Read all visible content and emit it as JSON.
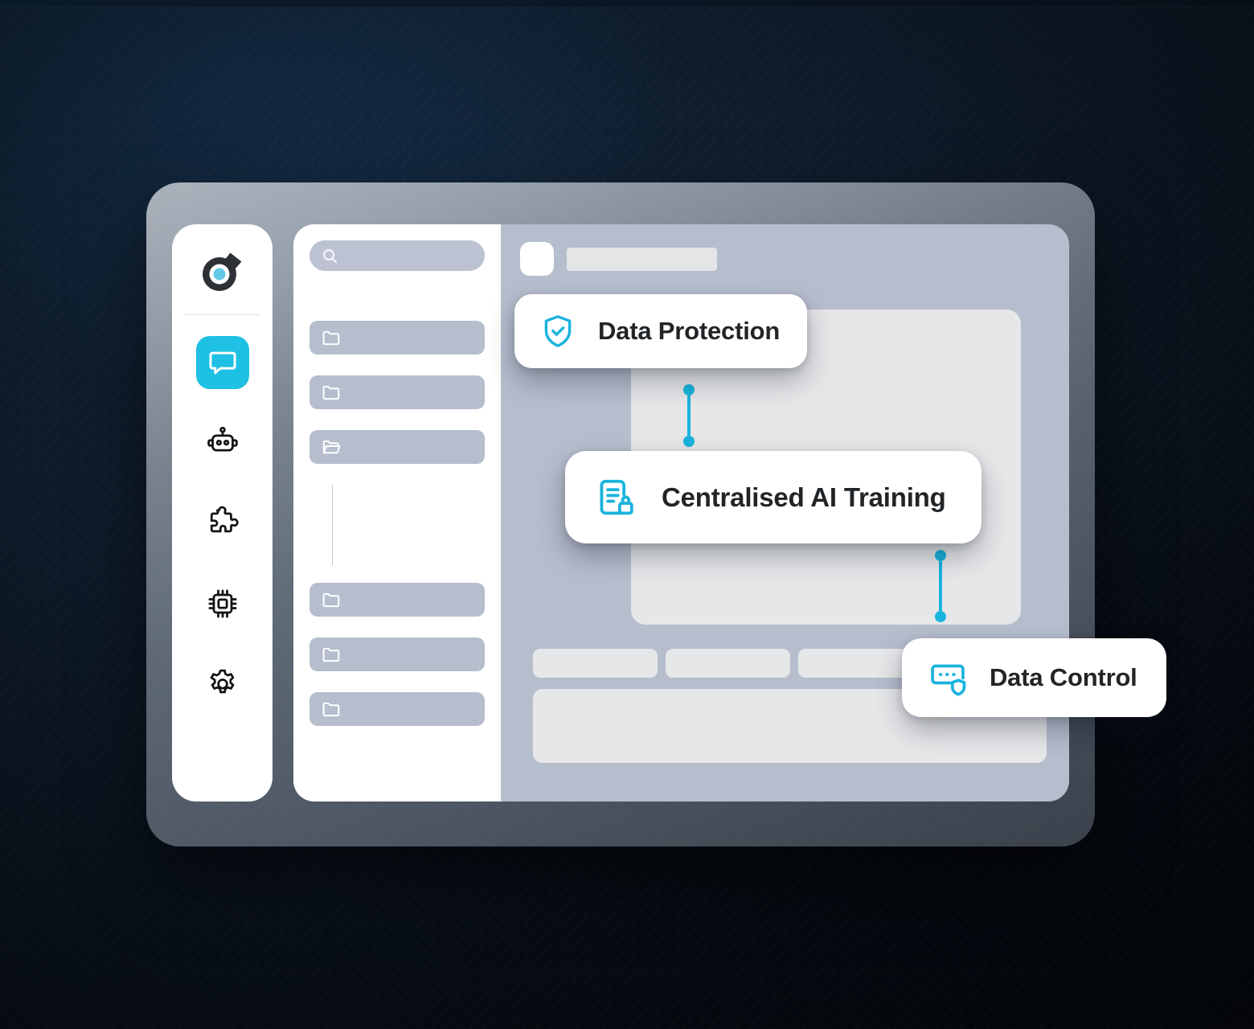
{
  "background": {
    "base_color": "#0d1a26",
    "accent_color": "#1ec0e3"
  },
  "brand": {
    "logo_icon": "target-pan-logo-icon",
    "logo_ring_color": "#2d3136",
    "logo_center_color": "#63c8e8"
  },
  "sidebar": {
    "items": [
      {
        "icon": "chat-bubble-icon",
        "active": true
      },
      {
        "icon": "robot-icon",
        "active": false
      },
      {
        "icon": "puzzle-piece-icon",
        "active": false
      },
      {
        "icon": "chip-icon",
        "active": false
      },
      {
        "icon": "gear-icon",
        "active": false
      }
    ]
  },
  "tree_panel": {
    "search": {
      "icon": "search-icon",
      "value": "",
      "placeholder": ""
    },
    "rows_top": [
      {
        "icon": "folder-closed-icon"
      },
      {
        "icon": "folder-closed-icon"
      },
      {
        "icon": "folder-open-icon"
      }
    ],
    "rows_bottom": [
      {
        "icon": "folder-closed-icon"
      },
      {
        "icon": "folder-closed-icon"
      },
      {
        "icon": "folder-closed-icon"
      }
    ]
  },
  "main": {
    "topbar": {
      "square_placeholder": "",
      "title_placeholder": ""
    },
    "chips": [
      "",
      "",
      ""
    ],
    "footer_block": ""
  },
  "badges": [
    {
      "id": "data-protection",
      "label": "Data Protection",
      "icon": "shield-check-icon",
      "icon_color": "#1ab3dd"
    },
    {
      "id": "centralised-ai-training",
      "label": "Centralised AI Training",
      "icon": "document-lock-icon",
      "icon_color": "#1ab3dd"
    },
    {
      "id": "data-control",
      "label": "Data Control",
      "icon": "server-shield-icon",
      "icon_color": "#1ab3dd"
    }
  ],
  "connectors": [
    {
      "from": "data-protection",
      "to": "centralised-ai-training",
      "color": "#1ab3dd"
    },
    {
      "from": "centralised-ai-training",
      "to": "data-control",
      "color": "#1ab3dd"
    }
  ]
}
